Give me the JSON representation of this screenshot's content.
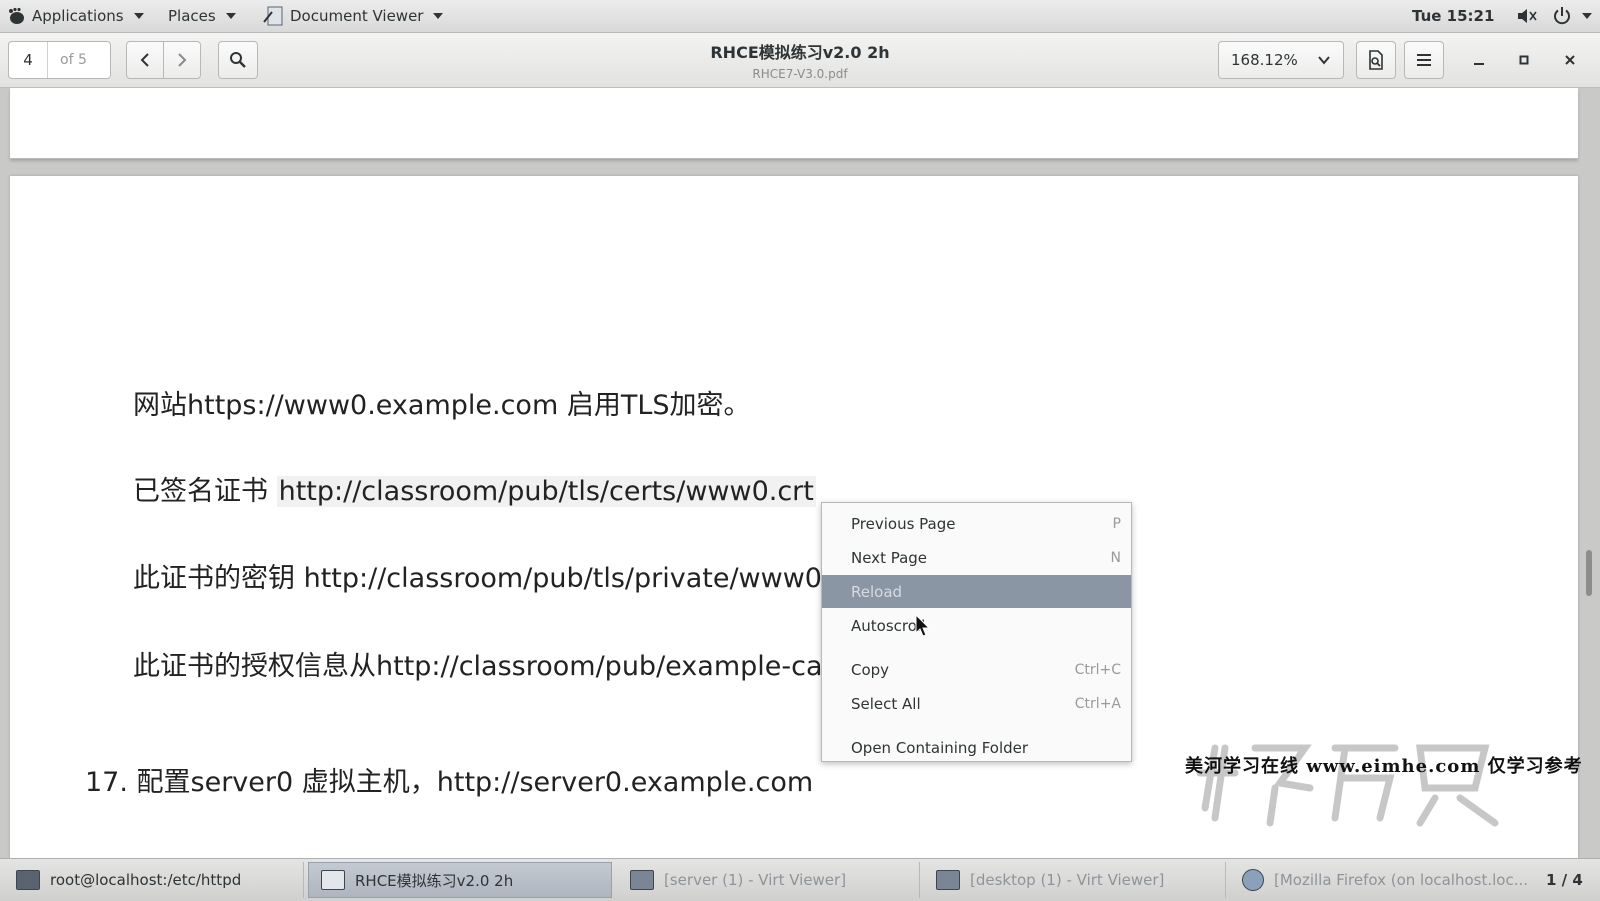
{
  "top_panel": {
    "applications": "Applications",
    "places": "Places",
    "active_app": "Document Viewer",
    "clock": "Tue 15:21"
  },
  "header": {
    "page_current": "4",
    "page_total": "of 5",
    "title": "RHCE模拟练习v2.0 2h",
    "subtitle": "RHCE7-V3.0.pdf",
    "zoom": "168.12%"
  },
  "document": {
    "line1": "网站https://www0.example.com  启用TLS加密。",
    "line2_label": "已签名证书",
    "line2_link": "http://classroom/pub/tls/certs/www0.crt",
    "line3": "此证书的密钥  http://classroom/pub/tls/private/www0",
    "line4": "此证书的授权信息从http://classroom/pub/example-ca",
    "line5": "17. 配置server0  虚拟主机，http://server0.example.com"
  },
  "context_menu": {
    "items": [
      {
        "label": "Previous Page",
        "accel": "P"
      },
      {
        "label": "Next Page",
        "accel": "N"
      },
      {
        "label": "Reload",
        "accel": ""
      },
      {
        "label": "Autoscroll",
        "accel": ""
      },
      {
        "label": "Copy",
        "accel": "Ctrl+C"
      },
      {
        "label": "Select All",
        "accel": "Ctrl+A"
      },
      {
        "label": "Open Containing Folder",
        "accel": ""
      }
    ],
    "highlighted_index": 2
  },
  "overlay": {
    "watermark_text": "美河学习在线  www.eimhe.com  仅学习参考"
  },
  "taskbar": {
    "tasks": [
      {
        "label": "root@localhost:/etc/httpd"
      },
      {
        "label": "RHCE模拟练习v2.0 2h"
      },
      {
        "label": "[server (1) - Virt Viewer]"
      },
      {
        "label": "[desktop (1) - Virt Viewer]"
      },
      {
        "label": "[Mozilla Firefox (on localhost.loc..."
      }
    ],
    "workspace": "1 / 4"
  },
  "colors": {
    "menu_highlight": "#8b96a5",
    "active_task": "#b6bdc6"
  }
}
